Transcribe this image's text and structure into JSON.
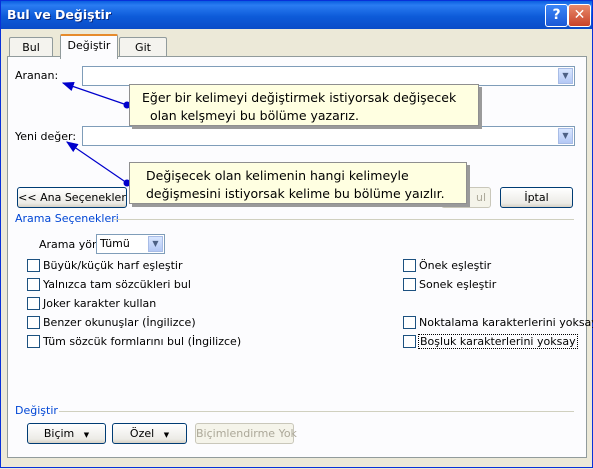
{
  "window": {
    "title": "Bul ve Değiştir",
    "help_glyph": "?",
    "close_glyph": "✕"
  },
  "tabs": [
    {
      "label": "Bul"
    },
    {
      "label": "Değiştir"
    },
    {
      "label": "Git"
    }
  ],
  "find": {
    "label": "Aranan:",
    "value": ""
  },
  "replace": {
    "label": "Yeni değer:",
    "value": ""
  },
  "callouts": {
    "find_note": [
      "Eğer bir kelimeyi değiştirmek istiyorsak değişecek",
      "olan kelşmeyi bu bölüme yazarız."
    ],
    "replace_note": [
      "Değişecek olan kelimenin hangi kelimeyle",
      "değişmesini istiyorsak kelime bu bölüme yaızlır."
    ]
  },
  "buttons": {
    "less_options": "<< Ana Seçenekler",
    "find_next_partial": "ul",
    "cancel": "İptal"
  },
  "search_options": {
    "group_label": "Arama Seçenekleri",
    "direction_label": "Arama yönü:",
    "direction_value": "Tümü",
    "left": [
      {
        "label": "Büyük/küçük harf eşleştir",
        "checked": false
      },
      {
        "label": "Yalnızca tam sözcükleri bul",
        "checked": false
      },
      {
        "label": "Joker karakter kullan",
        "checked": false
      },
      {
        "label": "Benzer okunuşlar (İngilizce)",
        "checked": false
      },
      {
        "label": "Tüm sözcük formlarını bul (İngilizce)",
        "checked": false
      }
    ],
    "right": [
      {
        "label": "Önek eşleştir",
        "checked": false
      },
      {
        "label": "Sonek eşleştir",
        "checked": false
      },
      {
        "label": "Noktalama karakterlerini yoksay",
        "checked": false
      },
      {
        "label": "Boşluk karakterlerini yoksay",
        "checked": false
      }
    ]
  },
  "replace_section": {
    "group_label": "Değiştir",
    "format": "Biçim",
    "special": "Özel",
    "no_formatting": "Biçimlendirme Yok"
  },
  "colors": {
    "title_bar": "#0A5FE0",
    "accent": "#0046D5",
    "note_bg": "#FFFFE1",
    "arrow": "#0000CC"
  }
}
